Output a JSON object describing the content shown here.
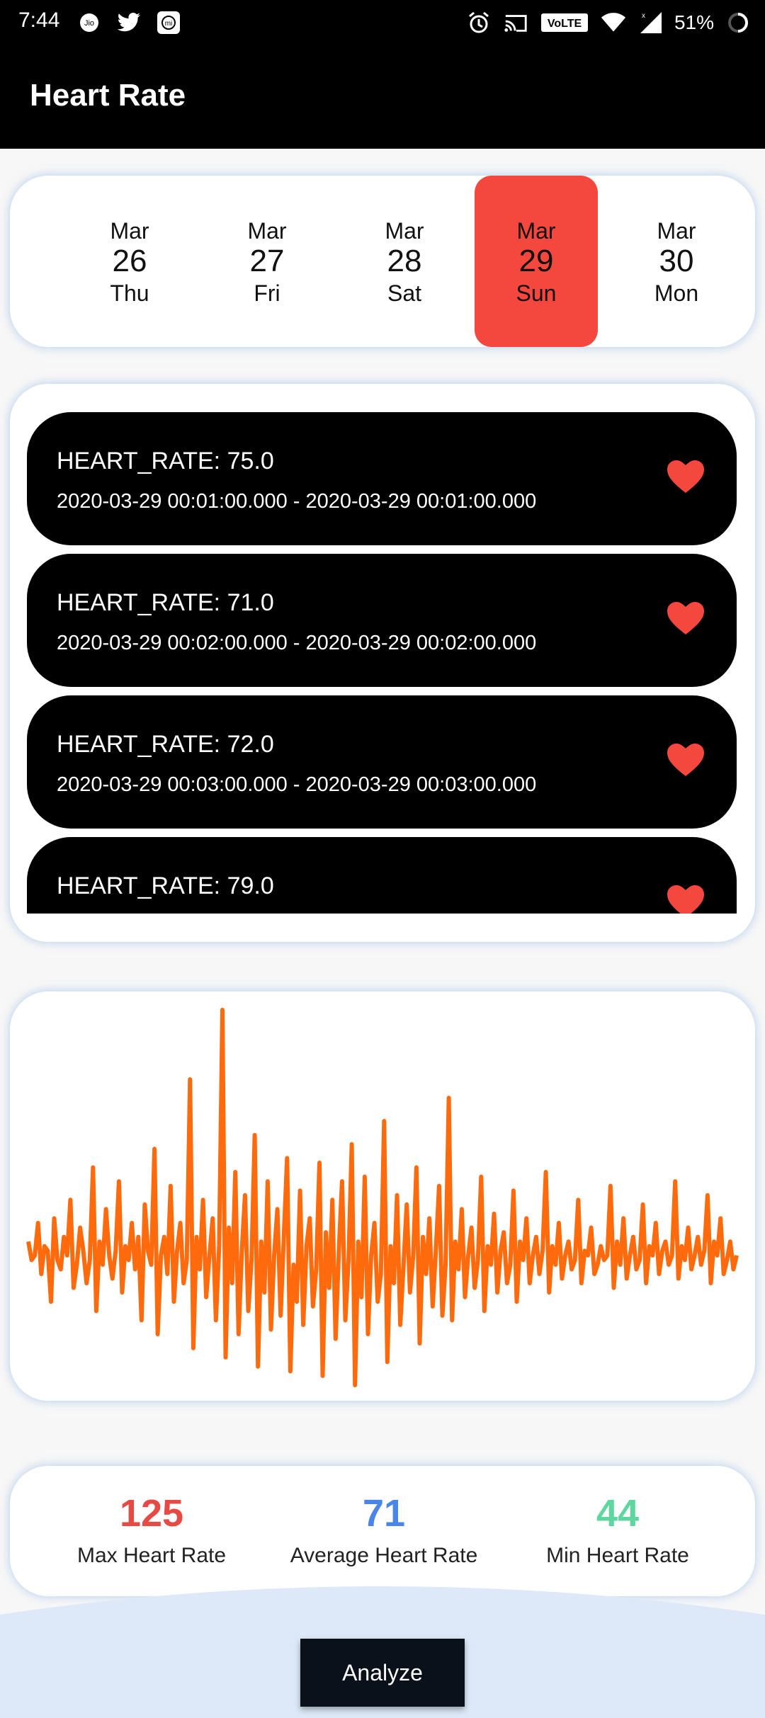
{
  "status_bar": {
    "time": "7:44",
    "battery": "51%",
    "network": "VoLTE",
    "left_icons": [
      "jio-icon",
      "twitter-icon",
      "mi-icon"
    ],
    "right_icons": [
      "alarm-icon",
      "cast-icon",
      "volte-icon",
      "wifi-icon",
      "signal-icon",
      "battery-icon"
    ]
  },
  "app_bar": {
    "title": "Heart Rate"
  },
  "date_selector": {
    "accent_color": "#f4473d",
    "dates": [
      {
        "month": "Mar",
        "day": "26",
        "weekday": "Thu",
        "selected": false
      },
      {
        "month": "Mar",
        "day": "27",
        "weekday": "Fri",
        "selected": false
      },
      {
        "month": "Mar",
        "day": "28",
        "weekday": "Sat",
        "selected": false
      },
      {
        "month": "Mar",
        "day": "29",
        "weekday": "Sun",
        "selected": true
      },
      {
        "month": "Mar",
        "day": "30",
        "weekday": "Mon",
        "selected": false
      }
    ]
  },
  "readings": [
    {
      "value": "HEART_RATE: 75.0",
      "range": "2020-03-29 00:01:00.000 - 2020-03-29 00:01:00.000"
    },
    {
      "value": "HEART_RATE: 71.0",
      "range": "2020-03-29 00:02:00.000 - 2020-03-29 00:02:00.000"
    },
    {
      "value": "HEART_RATE: 72.0",
      "range": "2020-03-29 00:03:00.000 - 2020-03-29 00:03:00.000"
    },
    {
      "value": "HEART_RATE: 79.0",
      "range": ""
    }
  ],
  "chart_data": {
    "type": "line",
    "series": [
      {
        "values": [
          75,
          71,
          72,
          79,
          68,
          74,
          73,
          62,
          80,
          71,
          69,
          76,
          72,
          84,
          65,
          70,
          78,
          73,
          66,
          71,
          91,
          60,
          75,
          70,
          82,
          72,
          67,
          73,
          88,
          64,
          74,
          71,
          79,
          69,
          76,
          58,
          83,
          73,
          70,
          95,
          55,
          72,
          76,
          68,
          87,
          62,
          73,
          79,
          66,
          71,
          110,
          52,
          76,
          69,
          84,
          63,
          72,
          80,
          58,
          74,
          125,
          50,
          78,
          66,
          90,
          55,
          73,
          85,
          60,
          71,
          98,
          48,
          75,
          64,
          88,
          56,
          72,
          82,
          59,
          76,
          93,
          47,
          70,
          62,
          86,
          57,
          74,
          80,
          61,
          69,
          92,
          46,
          77,
          65,
          84,
          54,
          73,
          88,
          58,
          71,
          96,
          44,
          75,
          63,
          89,
          55,
          72,
          79,
          62,
          68,
          101,
          49,
          74,
          66,
          85,
          57,
          70,
          83,
          64,
          72,
          91,
          53,
          76,
          68,
          80,
          61,
          73,
          87,
          59,
          70,
          106,
          58,
          75,
          69,
          82,
          63,
          72,
          78,
          65,
          71,
          89,
          60,
          74,
          70,
          81,
          64,
          73,
          77,
          66,
          70,
          86,
          62,
          75,
          71,
          80,
          66,
          72,
          76,
          68,
          73,
          90,
          64,
          74,
          70,
          79,
          67,
          72,
          75,
          69,
          71,
          84,
          66,
          73,
          72,
          78,
          68,
          70,
          74,
          71,
          72,
          87,
          65,
          75,
          70,
          80,
          67,
          72,
          76,
          69,
          71,
          83,
          66,
          74,
          72,
          79,
          68,
          73,
          75,
          70,
          72,
          88,
          67,
          74,
          71,
          78,
          69,
          72,
          76,
          70,
          73,
          85,
          66,
          75,
          72,
          80,
          68,
          71,
          75,
          69,
          72
        ]
      }
    ],
    "line_color": "#ff6a0d"
  },
  "stats": {
    "max": {
      "value": "125",
      "label": "Max Heart Rate",
      "color": "#e64a45"
    },
    "avg": {
      "value": "71",
      "label": "Average Heart Rate",
      "color": "#4a86e8"
    },
    "min": {
      "value": "44",
      "label": "Min Heart Rate",
      "color": "#5ed6a0"
    }
  },
  "analyze_button": {
    "label": "Analyze"
  }
}
